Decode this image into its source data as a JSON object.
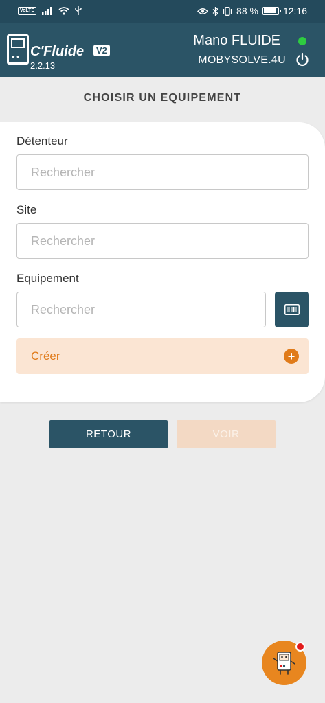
{
  "status_bar": {
    "volte": "VoLTE",
    "battery": "88 %",
    "time": "12:16"
  },
  "header": {
    "app_name": "C'Fluide",
    "app_badge": "V2",
    "version": "2.2.13",
    "user_name": "Mano FLUIDE",
    "company": "MOBYSOLVE.4U",
    "online_color": "#2ecc40",
    "brand_color": "#2b5466"
  },
  "page": {
    "title": "CHOISIR UN EQUIPEMENT"
  },
  "form": {
    "holder": {
      "label": "Détenteur",
      "placeholder": "Rechercher",
      "value": ""
    },
    "site": {
      "label": "Site",
      "placeholder": "Rechercher",
      "value": ""
    },
    "equipment": {
      "label": "Equipement",
      "placeholder": "Rechercher",
      "value": ""
    },
    "create_label": "Créer",
    "accent_color": "#e07b1a"
  },
  "actions": {
    "back_label": "RETOUR",
    "see_label": "VOIR"
  },
  "icons": {
    "signal": "signal-icon",
    "wifi": "wifi-icon",
    "usb": "usb-icon",
    "eye": "eye-icon",
    "bluetooth": "bluetooth-icon",
    "vibrate": "vibrate-icon",
    "battery": "battery-icon",
    "power": "power-icon",
    "barcode": "barcode-icon",
    "plus": "plus-circle-icon",
    "assistant": "assistant-mascot-icon"
  }
}
